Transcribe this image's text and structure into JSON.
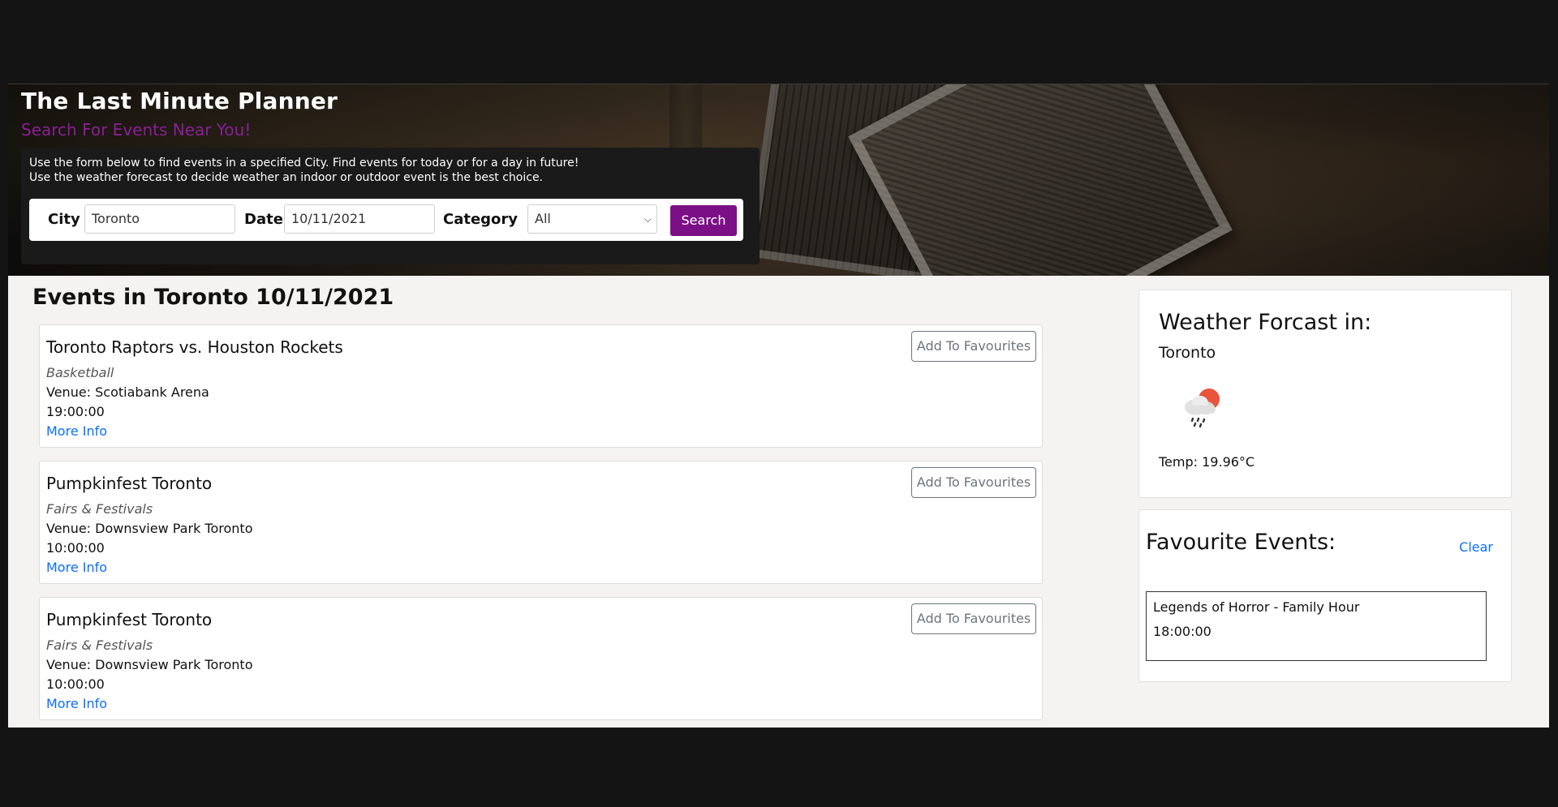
{
  "header": {
    "title": "The Last Minute Planner",
    "subtitle": "Search For Events Near You!",
    "description_line1": "Use the form below to find events in a specified City. Find events for today or for a day in future!",
    "description_line2": "Use the weather forecast to decide weather an indoor or outdoor event is the best choice."
  },
  "form": {
    "city_label": "City",
    "city_value": "Toronto",
    "date_label": "Date",
    "date_value": "10/11/2021",
    "category_label": "Category",
    "category_value": "All",
    "search_label": "Search"
  },
  "events": {
    "heading": "Events in Toronto 10/11/2021",
    "fav_button_label": "Add To Favourites",
    "more_info_label": "More Info",
    "items": [
      {
        "name": "Toronto Raptors vs. Houston Rockets",
        "category": "Basketball",
        "venue": "Venue: Scotiabank Arena",
        "time": "19:00:00"
      },
      {
        "name": "Pumpkinfest Toronto",
        "category": "Fairs & Festivals",
        "venue": "Venue: Downsview Park Toronto",
        "time": "10:00:00"
      },
      {
        "name": "Pumpkinfest Toronto",
        "category": "Fairs & Festivals",
        "venue": "Venue: Downsview Park Toronto",
        "time": "10:00:00"
      }
    ]
  },
  "weather": {
    "heading": "Weather Forcast in:",
    "city": "Toronto",
    "icon": "rain-cloud-sun-icon",
    "temp": "Temp: 19.96°C"
  },
  "favourites": {
    "heading": "Favourite Events:",
    "clear_label": "Clear",
    "items": [
      {
        "name": "Legends of Horror - Family Hour",
        "time": "18:00:00"
      }
    ]
  },
  "colors": {
    "accent": "#7b0f86",
    "link": "#0b6efd",
    "page_bg": "#f4f3f1",
    "outer_bg": "#141414"
  }
}
